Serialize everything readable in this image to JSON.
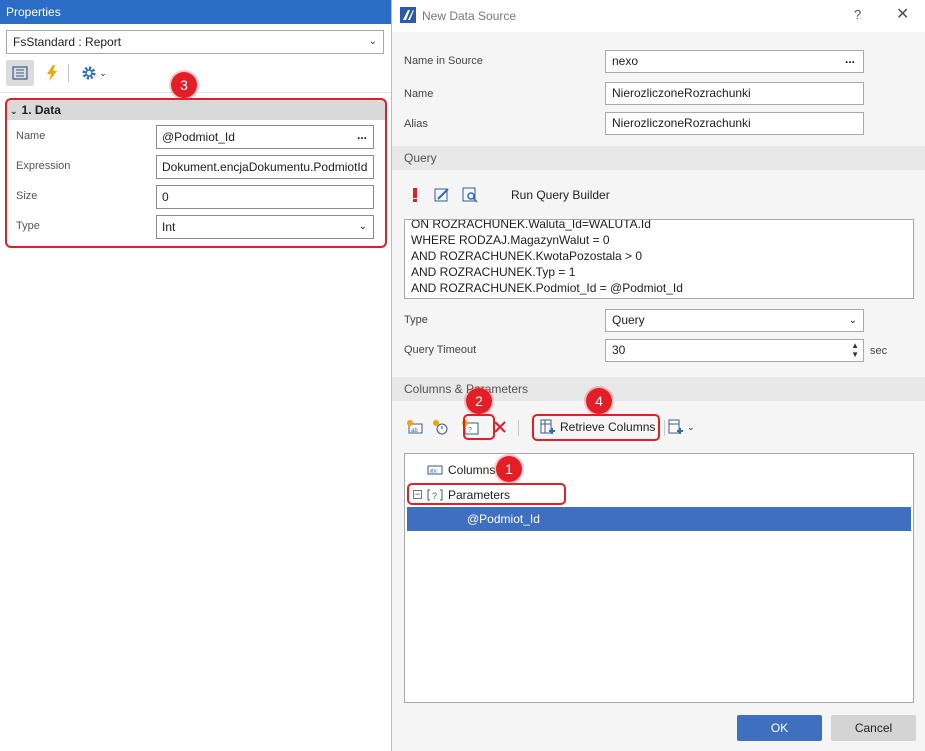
{
  "properties": {
    "title": "Properties",
    "object_selector": "FsStandard : Report",
    "category": "1. Data",
    "rows": [
      {
        "label": "Name",
        "value": "@Podmiot_Id",
        "editor": "ellipsis"
      },
      {
        "label": "Expression",
        "value": "Dokument.encjaDokumentu.PodmiotId",
        "editor": "text"
      },
      {
        "label": "Size",
        "value": "0",
        "editor": "text"
      },
      {
        "label": "Type",
        "value": "Int",
        "editor": "dropdown"
      }
    ]
  },
  "dialog": {
    "title": "New Data Source",
    "help": "?",
    "close": "✕",
    "name_in_source": {
      "label": "Name in Source",
      "value": "nexo"
    },
    "name": {
      "label": "Name",
      "value": "NierozliczoneRozrachunki"
    },
    "alias": {
      "label": "Alias",
      "value": "NierozliczoneRozrachunki"
    },
    "query_section": "Query",
    "run_query_builder": "Run Query Builder",
    "query_lines": [
      "ON ROZRACHUNEK.Waluta_Id=WALUTA.Id",
      "WHERE RODZAJ.MagazynWalut = 0",
      "AND ROZRACHUNEK.KwotaPozostala > 0",
      "AND ROZRACHUNEK.Typ = 1",
      "AND ROZRACHUNEK.Podmiot_Id = @Podmiot_Id"
    ],
    "type": {
      "label": "Type",
      "value": "Query"
    },
    "timeout": {
      "label": "Query Timeout",
      "value": "30",
      "unit": "sec"
    },
    "columns_section": "Columns & Parameters",
    "retrieve_columns": "Retrieve Columns",
    "tree": {
      "columns": "Columns",
      "parameters": "Parameters",
      "collapse": "−",
      "param_item": "@Podmiot_Id"
    },
    "ok": "OK",
    "cancel": "Cancel"
  },
  "annotations": {
    "m1": "1",
    "m2": "2",
    "m3": "3",
    "m4": "4"
  },
  "colors": {
    "accent": "#2b6cc4",
    "selection": "#3f6fbf",
    "annotation": "#e41e26"
  }
}
